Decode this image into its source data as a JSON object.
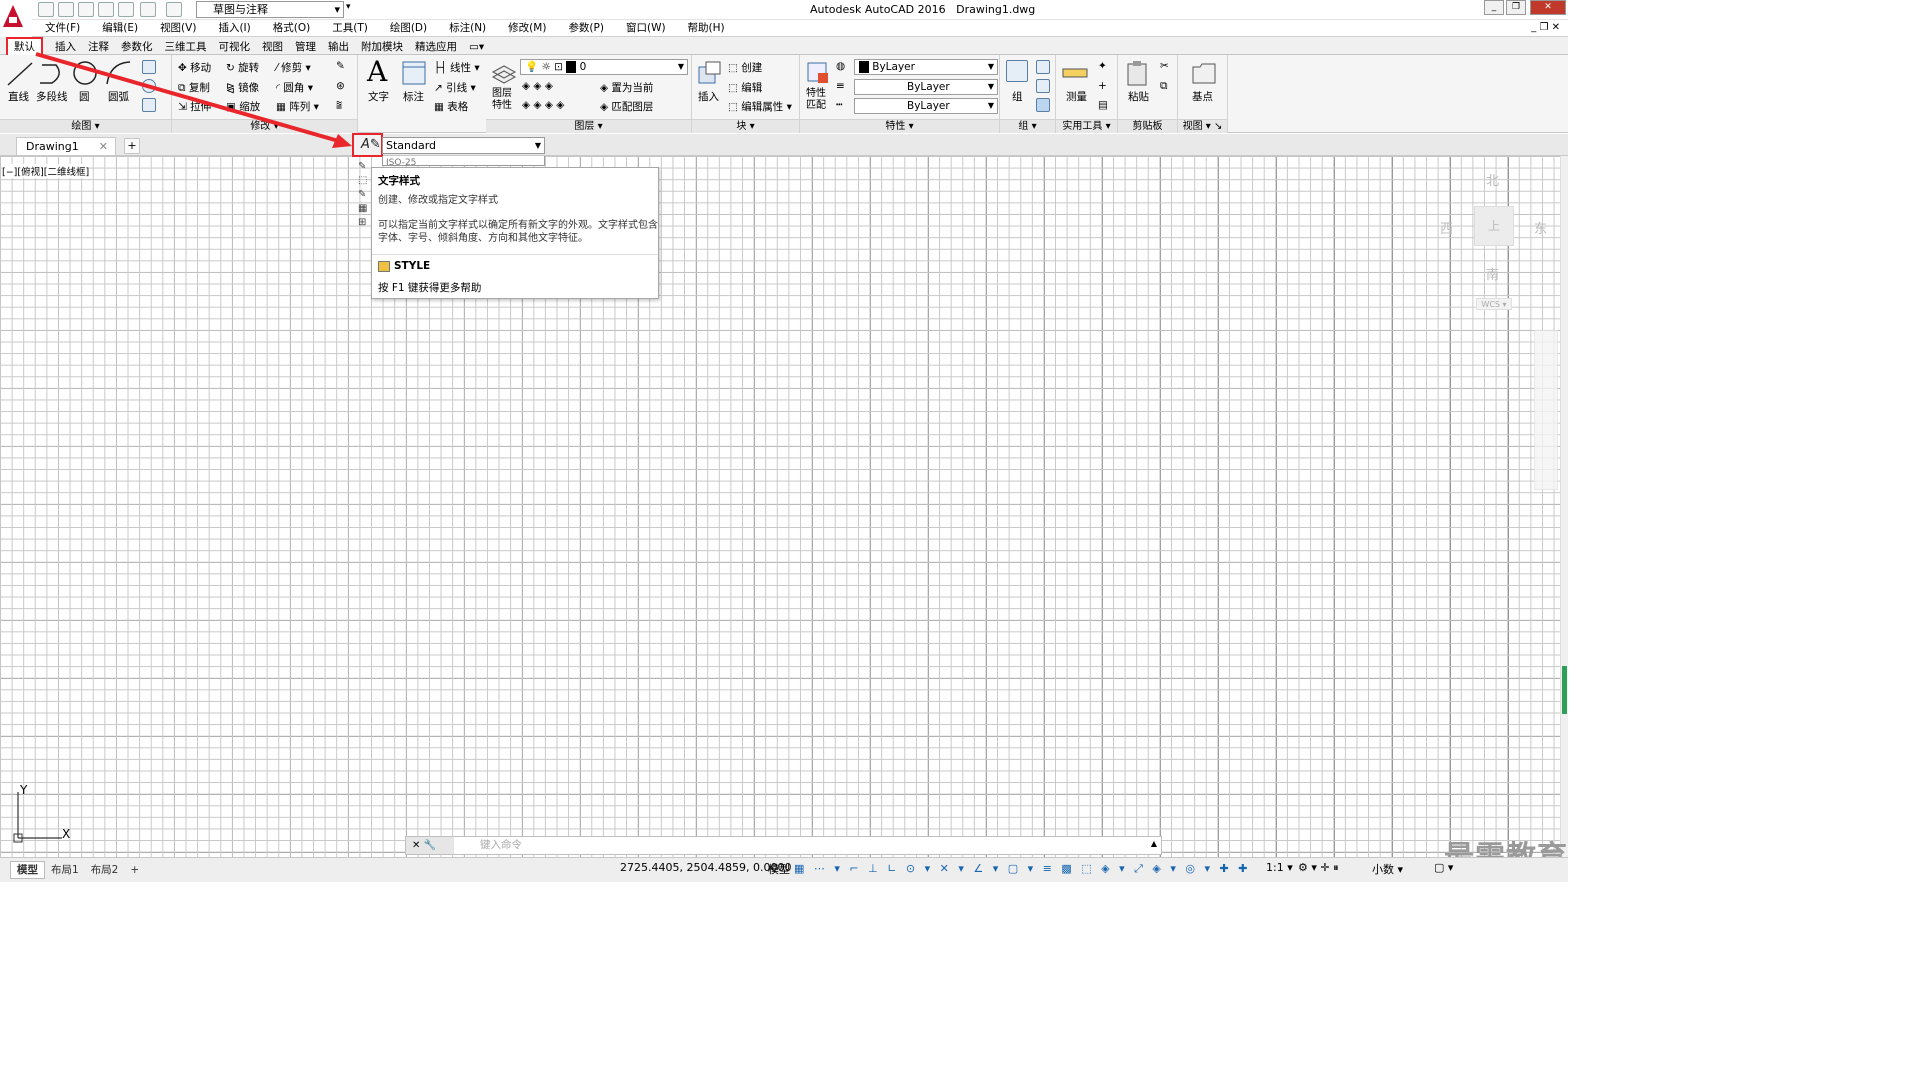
{
  "titlebar": {
    "app": "Autodesk AutoCAD 2016",
    "file": "Drawing1.dwg",
    "workspace": "草图与注释"
  },
  "menu": [
    "文件(F)",
    "编辑(E)",
    "视图(V)",
    "插入(I)",
    "格式(O)",
    "工具(T)",
    "绘图(D)",
    "标注(N)",
    "修改(M)",
    "参数(P)",
    "窗口(W)",
    "帮助(H)"
  ],
  "ribbon_tabs": [
    "默认",
    "插入",
    "注释",
    "参数化",
    "三维工具",
    "可视化",
    "视图",
    "管理",
    "输出",
    "附加模块",
    "精选应用"
  ],
  "draw": {
    "title": "绘图",
    "line": "直线",
    "polyline": "多段线",
    "circle": "圆",
    "arc": "圆弧"
  },
  "modify": {
    "title": "修改",
    "move": "移动",
    "rotate": "旋转",
    "trim": "修剪",
    "copy": "复制",
    "mirror": "镜像",
    "fillet": "圆角",
    "stretch": "拉伸",
    "scale": "缩放",
    "array": "阵列"
  },
  "annotation": {
    "text": "文字",
    "dim": "标注",
    "linear": "线性",
    "leader": "引线",
    "table": "表格"
  },
  "layers": {
    "title": "图层",
    "props": "图层特性",
    "layer_value": "0",
    "set_current": "置为当前",
    "match": "匹配图层"
  },
  "block": {
    "title": "块",
    "insert": "插入",
    "create": "创建",
    "edit": "编辑",
    "edit_attr": "编辑属性"
  },
  "properties": {
    "title": "特性",
    "match": "特性匹配",
    "color": "ByLayer",
    "linetype": "ByLayer",
    "lineweight": "ByLayer"
  },
  "groups": {
    "title": "组",
    "group": "组"
  },
  "utilities": {
    "title": "实用工具",
    "measure": "测量"
  },
  "clipboard": {
    "title": "剪贴板",
    "paste": "粘贴"
  },
  "view": {
    "title": "视图",
    "base": "基点"
  },
  "doc_tab": "Drawing1",
  "viewport_label": "[−][俯视][二维线框]",
  "text_style": {
    "value": "Standard",
    "dim_style": "ISO-25"
  },
  "tooltip": {
    "title": "文字样式",
    "summary": "创建、修改或指定文字样式",
    "detail": "可以指定当前文字样式以确定所有新文字的外观。文字样式包含字体、字号、倾斜角度、方向和其他文字特征。",
    "command": "STYLE",
    "help": "按 F1 键获得更多帮助"
  },
  "viewcube": {
    "n": "北",
    "s": "南",
    "e": "东",
    "w": "西",
    "top": "上",
    "wcs": "WCS"
  },
  "command_placeholder": "键入命令",
  "layout_tabs": [
    "模型",
    "布局1",
    "布局2"
  ],
  "status": {
    "coords": "2725.4405, 2504.4859, 0.0000",
    "model": "模型",
    "scale": "1:1",
    "units": "小数"
  },
  "watermark": "最需教育",
  "ucs": {
    "x": "X",
    "y": "Y"
  }
}
